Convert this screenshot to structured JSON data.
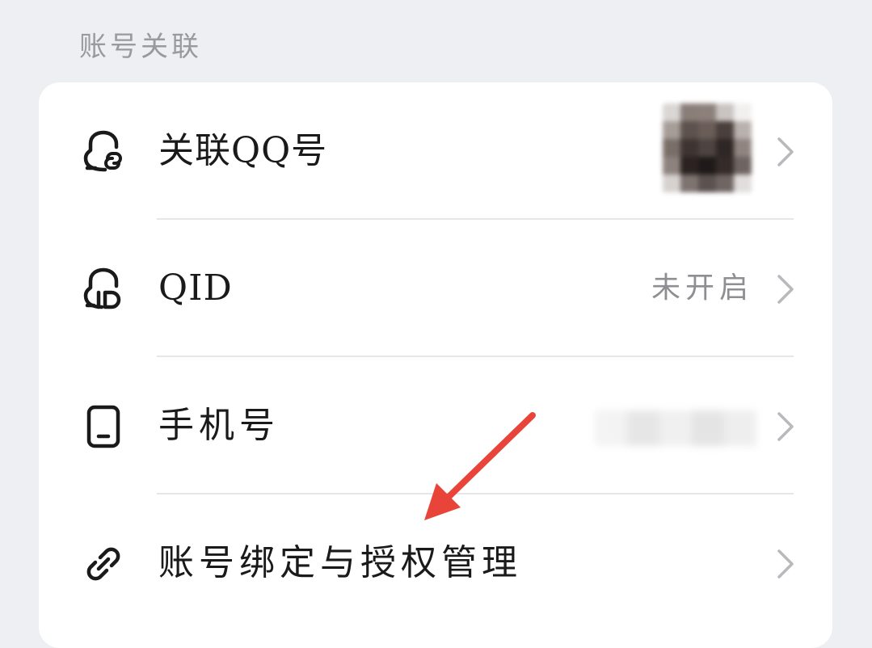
{
  "section": {
    "title": "账号关联"
  },
  "rows": [
    {
      "label": "关联QQ号",
      "value": "",
      "icon": "qq-link-icon"
    },
    {
      "label": "QID",
      "value": "未开启",
      "icon": "qid-icon"
    },
    {
      "label": "手机号",
      "value": "",
      "icon": "phone-icon"
    },
    {
      "label": "账号绑定与授权管理",
      "value": "",
      "icon": "link-icon"
    }
  ],
  "colors": {
    "background": "#eeeff2",
    "card": "#ffffff",
    "text": "#1a1a1a",
    "secondary_text": "#8e8e93",
    "chevron": "#b8b8bd",
    "annotation_arrow": "#e8443a"
  }
}
